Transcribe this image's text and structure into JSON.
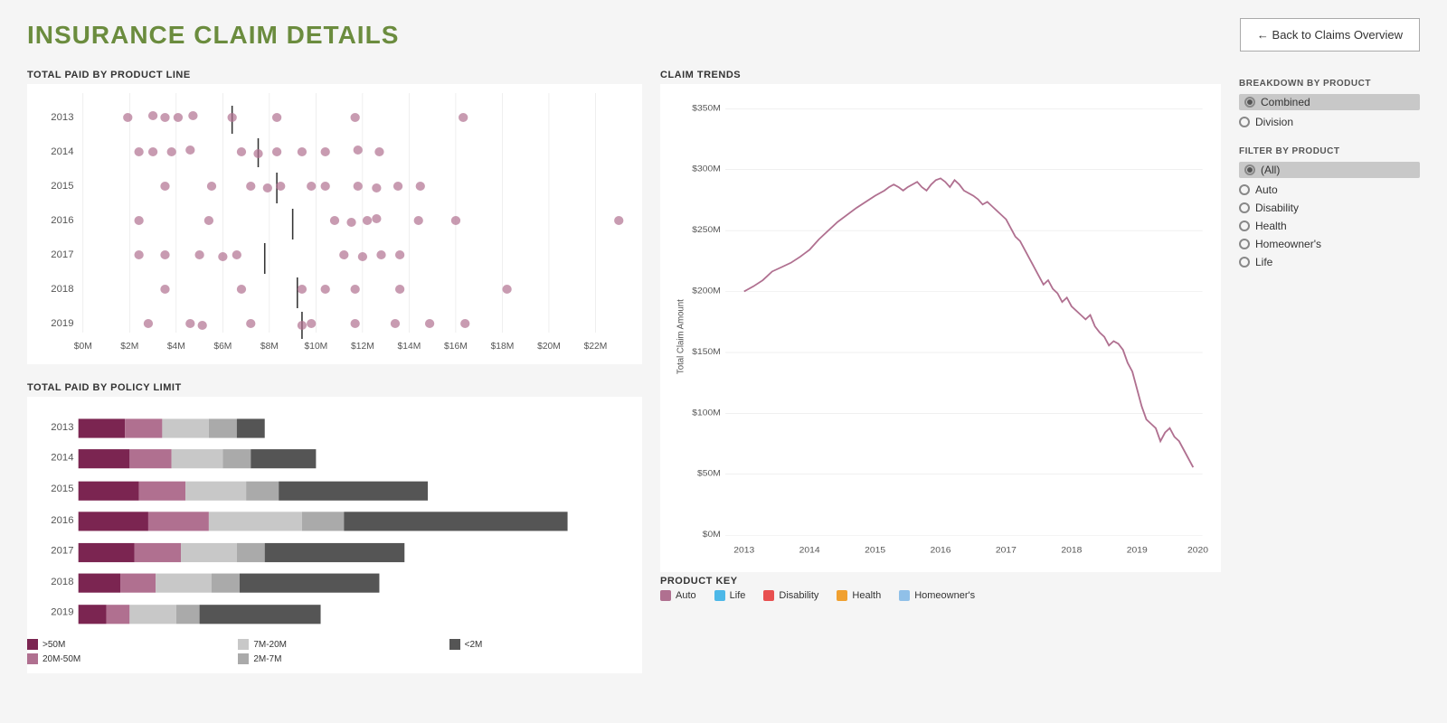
{
  "page": {
    "title": "INSURANCE CLAIM DETAILS",
    "back_button": "← Back to Claims Overview"
  },
  "dot_chart": {
    "title": "TOTAL PAID BY PRODUCT LINE",
    "x_labels": [
      "$0M",
      "$2M",
      "$4M",
      "$6M",
      "$8M",
      "$10M",
      "$12M",
      "$14M",
      "$16M",
      "$18M",
      "$20M",
      "$22M"
    ],
    "years": [
      "2013",
      "2014",
      "2015",
      "2016",
      "2017",
      "2018",
      "2019"
    ],
    "dot_color": "#b07090"
  },
  "bar_chart": {
    "title": "TOTAL PAID BY POLICY LIMIT",
    "years": [
      "2013",
      "2014",
      "2015",
      "2016",
      "2017",
      "2018",
      "2019"
    ],
    "legend": {
      "items": [
        {
          "label": ">50M",
          "color": "#7b2551"
        },
        {
          "label": "20M-50M",
          "color": "#b07090"
        },
        {
          "label": "7M-20M",
          "color": "#c8c8c8"
        },
        {
          "label": "2M-7M",
          "color": "#aaaaaa"
        },
        {
          "label": "<2M",
          "color": "#555555"
        }
      ]
    }
  },
  "breakdown": {
    "label": "BREAKDOWN BY PRODUCT",
    "options": [
      {
        "label": "Combined",
        "selected": true
      },
      {
        "label": "Division",
        "selected": false
      }
    ]
  },
  "filter": {
    "label": "FILTER BY PRODUCT",
    "options": [
      {
        "label": "(All)",
        "selected": true
      },
      {
        "label": "Auto",
        "selected": false
      },
      {
        "label": "Disability",
        "selected": false
      },
      {
        "label": "Health",
        "selected": false
      },
      {
        "label": "Homeowner's",
        "selected": false
      },
      {
        "label": "Life",
        "selected": false
      }
    ]
  },
  "trend_chart": {
    "title": "CLAIM TRENDS",
    "y_labels": [
      "$350M",
      "$300M",
      "$250M",
      "$200M",
      "$150M",
      "$100M",
      "$50M",
      "$0M"
    ],
    "x_labels": [
      "2013",
      "2014",
      "2015",
      "2016",
      "2017",
      "2018",
      "2019",
      "2020"
    ],
    "y_axis_label": "Total Claim Amount"
  },
  "product_key": {
    "label": "PRODUCT KEY",
    "items": [
      {
        "label": "Auto",
        "color": "#b07090"
      },
      {
        "label": "Life",
        "color": "#4db8e8"
      },
      {
        "label": "Disability",
        "color": "#e85050"
      },
      {
        "label": "Health",
        "color": "#f0a030"
      },
      {
        "label": "Homeowner's",
        "color": "#90c0e8"
      }
    ]
  }
}
